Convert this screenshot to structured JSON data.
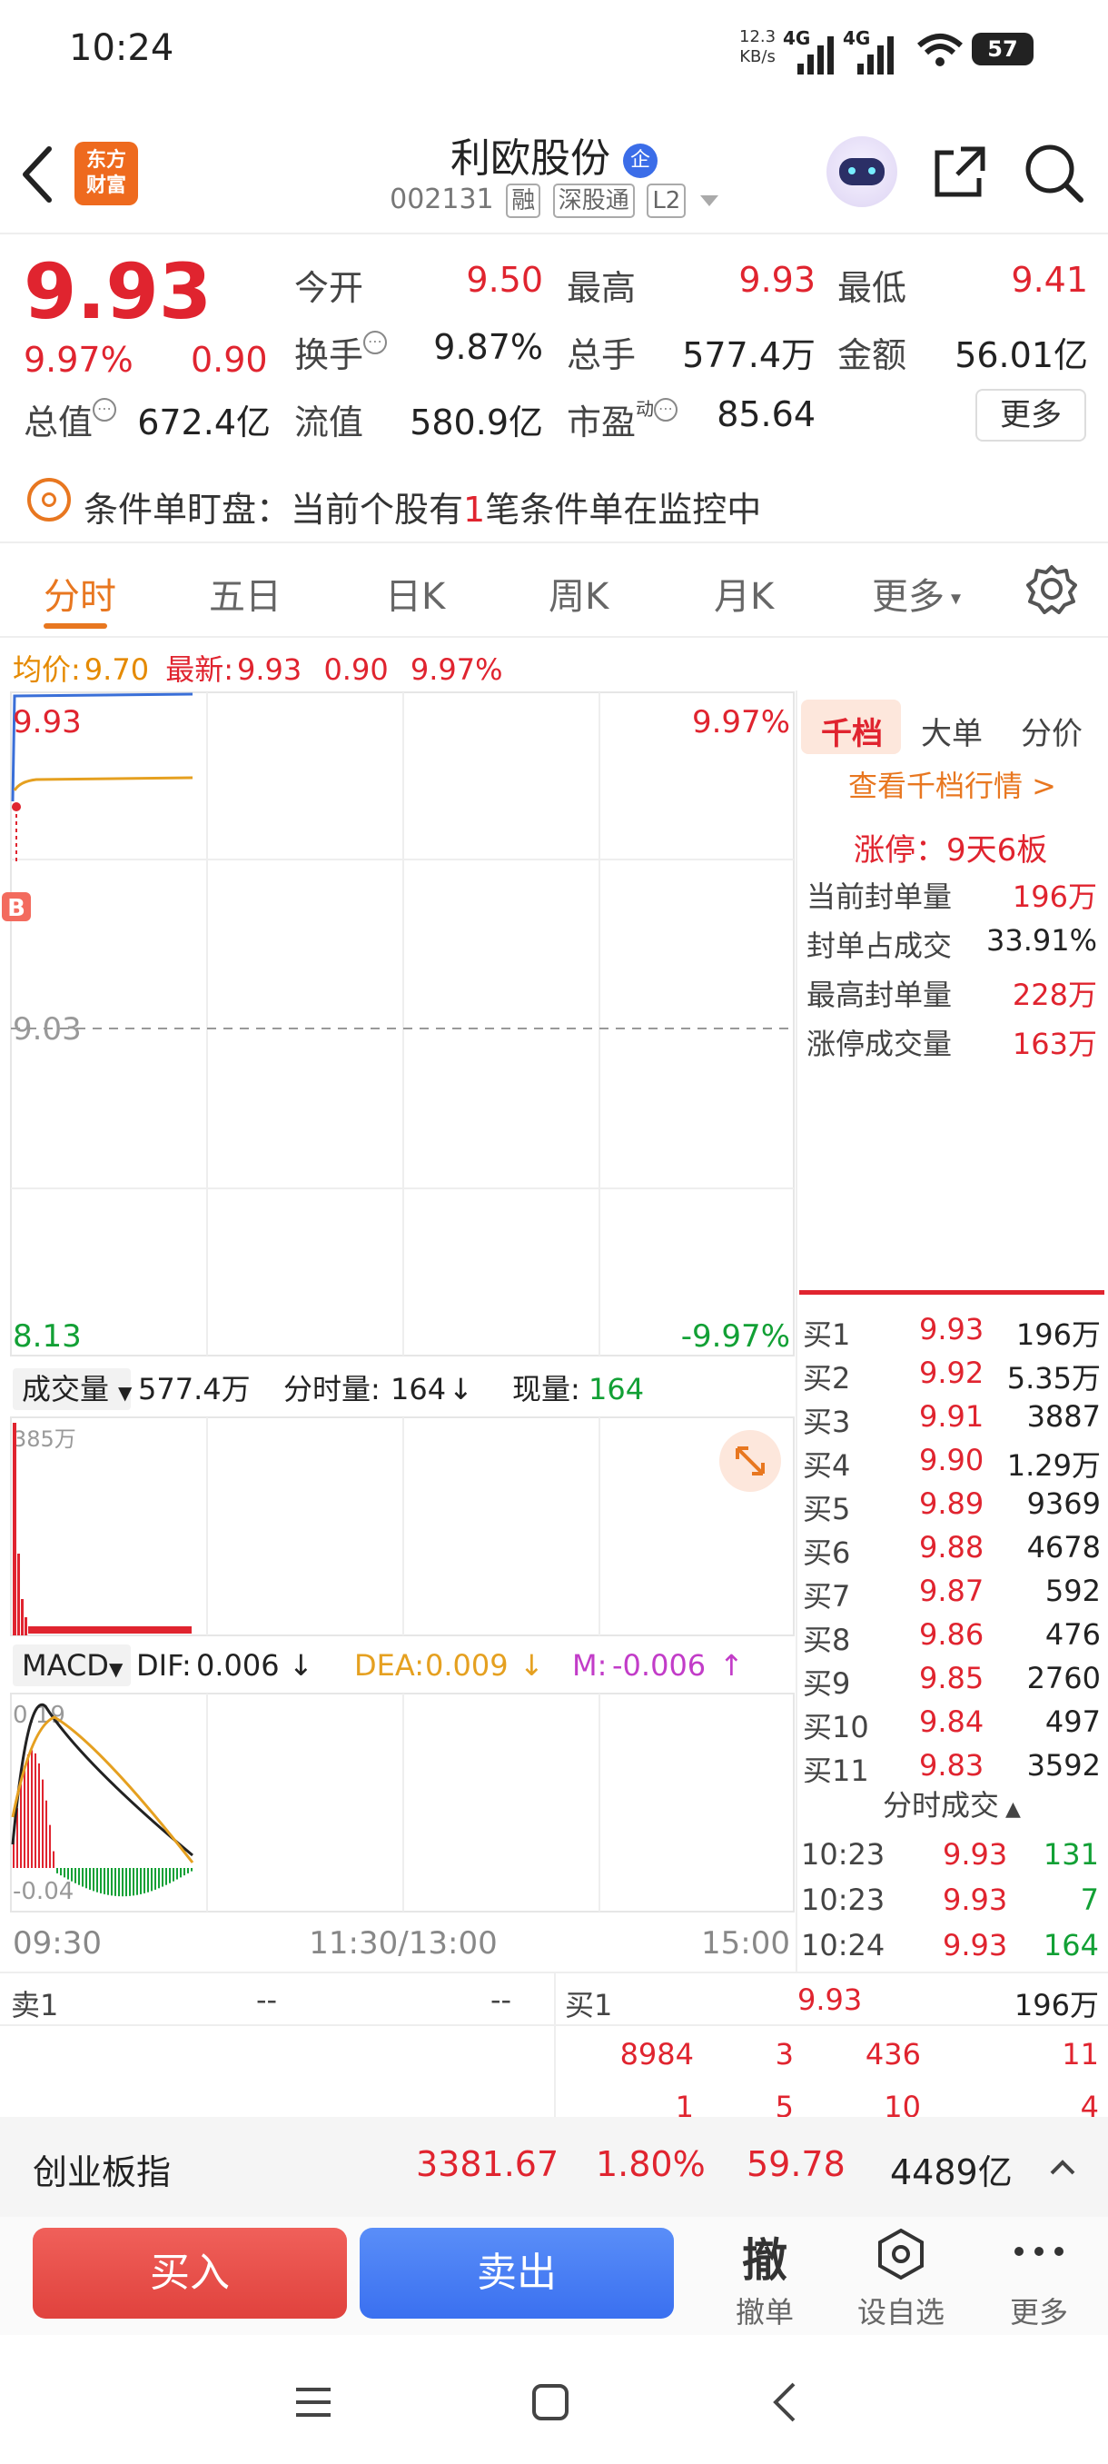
{
  "status_bar": {
    "time": "10:24",
    "net_speed_top": "12.3",
    "net_speed_unit": "KB/s",
    "signal1_label": "4G",
    "signal2_label": "4G",
    "battery": "57"
  },
  "header": {
    "logo_line1": "东方",
    "logo_line2": "财富",
    "stock_name": "利欧股份",
    "qi_badge": "企",
    "stock_code": "002131",
    "tags": [
      "融",
      "深股通",
      "L2"
    ]
  },
  "quote": {
    "price": "9.93",
    "change_pct": "9.97%",
    "change_amt": "0.90",
    "fields": [
      {
        "label": "今开",
        "value": "9.50",
        "color": "red"
      },
      {
        "label": "最高",
        "value": "9.93",
        "color": "red"
      },
      {
        "label": "最低",
        "value": "9.41",
        "color": "red"
      },
      {
        "label": "换手",
        "value": "9.87%",
        "color": "dark"
      },
      {
        "label": "总手",
        "value": "577.4万",
        "color": "dark"
      },
      {
        "label": "金额",
        "value": "56.01亿",
        "color": "dark"
      },
      {
        "label": "总值",
        "value": "672.4亿",
        "color": "dark"
      },
      {
        "label": "流值",
        "value": "580.9亿",
        "color": "dark"
      },
      {
        "label": "市盈",
        "value": "85.64",
        "color": "dark"
      }
    ],
    "pe_sup": "动",
    "more_label": "更多"
  },
  "condition": {
    "text_before": "条件单盯盘：当前个股有",
    "count": "1",
    "text_after": "笔条件单在监控中"
  },
  "tabs": [
    {
      "label": "分时",
      "active": true
    },
    {
      "label": "五日",
      "active": false
    },
    {
      "label": "日K",
      "active": false
    },
    {
      "label": "周K",
      "active": false
    },
    {
      "label": "月K",
      "active": false
    },
    {
      "label": "更多",
      "active": false
    }
  ],
  "chart_info": {
    "avg_label": "均价:",
    "avg_value": "9.70",
    "latest_label": "最新:",
    "latest_value": "9.93",
    "change_amt": "0.90",
    "change_pct": "9.97%"
  },
  "chart_data": {
    "type": "line",
    "price_axis": {
      "top": "9.93",
      "mid": "9.03",
      "bottom": "8.13"
    },
    "pct_axis": {
      "top": "9.97%",
      "bottom": "-9.97%"
    },
    "time_axis": [
      "09:30",
      "11:30/13:00",
      "15:00"
    ],
    "b_marker": "B",
    "volume": {
      "selector_label": "成交量",
      "total": "577.4万",
      "minute_label": "分时量:",
      "minute_value": "164",
      "current_label": "现量:",
      "current_value": "164",
      "max_label": "385万"
    },
    "macd": {
      "selector_label": "MACD",
      "dif_label": "DIF:",
      "dif_value": "0.006",
      "dea_label": "DEA:",
      "dea_value": "0.009",
      "m_label": "M:",
      "m_value": "-0.006",
      "top_label": "0.19",
      "bottom_label": "-0.04"
    }
  },
  "right_panel": {
    "tabs": [
      "千档",
      "大单",
      "分价"
    ],
    "link": "查看千档行情 >",
    "limit_up": "涨停：9天6板",
    "stats": [
      {
        "label": "当前封单量",
        "value": "196万",
        "color": "red"
      },
      {
        "label": "封单占成交",
        "value": "33.91%",
        "color": "dark"
      },
      {
        "label": "最高封单量",
        "value": "228万",
        "color": "red"
      },
      {
        "label": "涨停成交量",
        "value": "163万",
        "color": "red"
      }
    ],
    "bids": [
      {
        "label": "买1",
        "price": "9.93",
        "vol": "196万"
      },
      {
        "label": "买2",
        "price": "9.92",
        "vol": "5.35万"
      },
      {
        "label": "买3",
        "price": "9.91",
        "vol": "3887"
      },
      {
        "label": "买4",
        "price": "9.90",
        "vol": "1.29万"
      },
      {
        "label": "买5",
        "price": "9.89",
        "vol": "9369"
      },
      {
        "label": "买6",
        "price": "9.88",
        "vol": "4678"
      },
      {
        "label": "买7",
        "price": "9.87",
        "vol": "592"
      },
      {
        "label": "买8",
        "price": "9.86",
        "vol": "476"
      },
      {
        "label": "买9",
        "price": "9.85",
        "vol": "2760"
      },
      {
        "label": "买10",
        "price": "9.84",
        "vol": "497"
      },
      {
        "label": "买11",
        "price": "9.83",
        "vol": "3592"
      }
    ],
    "ticks_header": "分时成交",
    "ticks": [
      {
        "time": "10:23",
        "price": "9.93",
        "vol": "131"
      },
      {
        "time": "10:23",
        "price": "9.93",
        "vol": "7"
      },
      {
        "time": "10:24",
        "price": "9.93",
        "vol": "164"
      }
    ]
  },
  "bottom_quote": {
    "sell_label": "卖1",
    "sell_price": "--",
    "sell_vol": "--",
    "buy_label": "买1",
    "buy_price": "9.93",
    "buy_vol": "196万",
    "queue_row1": [
      "8984",
      "3",
      "436",
      "11"
    ],
    "queue_row2": [
      "1",
      "5",
      "10",
      "4"
    ]
  },
  "index_bar": {
    "name": "创业板指",
    "value": "3381.67",
    "pct": "1.80%",
    "change": "59.78",
    "amount": "4489亿"
  },
  "actions": {
    "buy": "买入",
    "sell": "卖出",
    "cancel_glyph": "撤",
    "cancel": "撤单",
    "watchlist": "设自选",
    "more": "更多"
  }
}
